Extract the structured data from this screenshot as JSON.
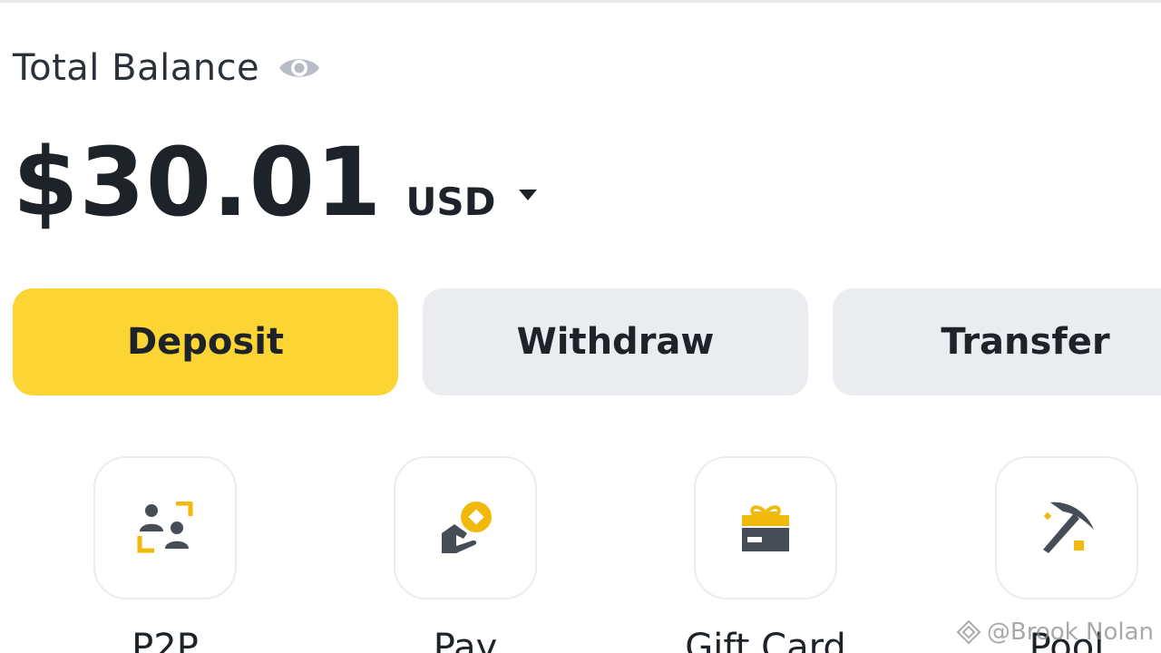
{
  "balance": {
    "label": "Total Balance",
    "amount": "$30.01",
    "currency": "USD"
  },
  "actions": {
    "deposit_label": "Deposit",
    "withdraw_label": "Withdraw",
    "transfer_label": "Transfer"
  },
  "shortcuts": [
    {
      "label": "P2P",
      "icon": "p2p-icon"
    },
    {
      "label": "Pay",
      "icon": "pay-icon"
    },
    {
      "label": "Gift Card",
      "icon": "gift-card-icon"
    },
    {
      "label": "Pool",
      "icon": "pool-icon"
    }
  ],
  "watermark": {
    "text": "@Brook Nolan"
  },
  "colors": {
    "accent": "#fcd535",
    "icon_dark": "#474d57",
    "icon_yellow": "#f0b90b",
    "button_gray": "#eaecef",
    "text": "#1e2329"
  }
}
